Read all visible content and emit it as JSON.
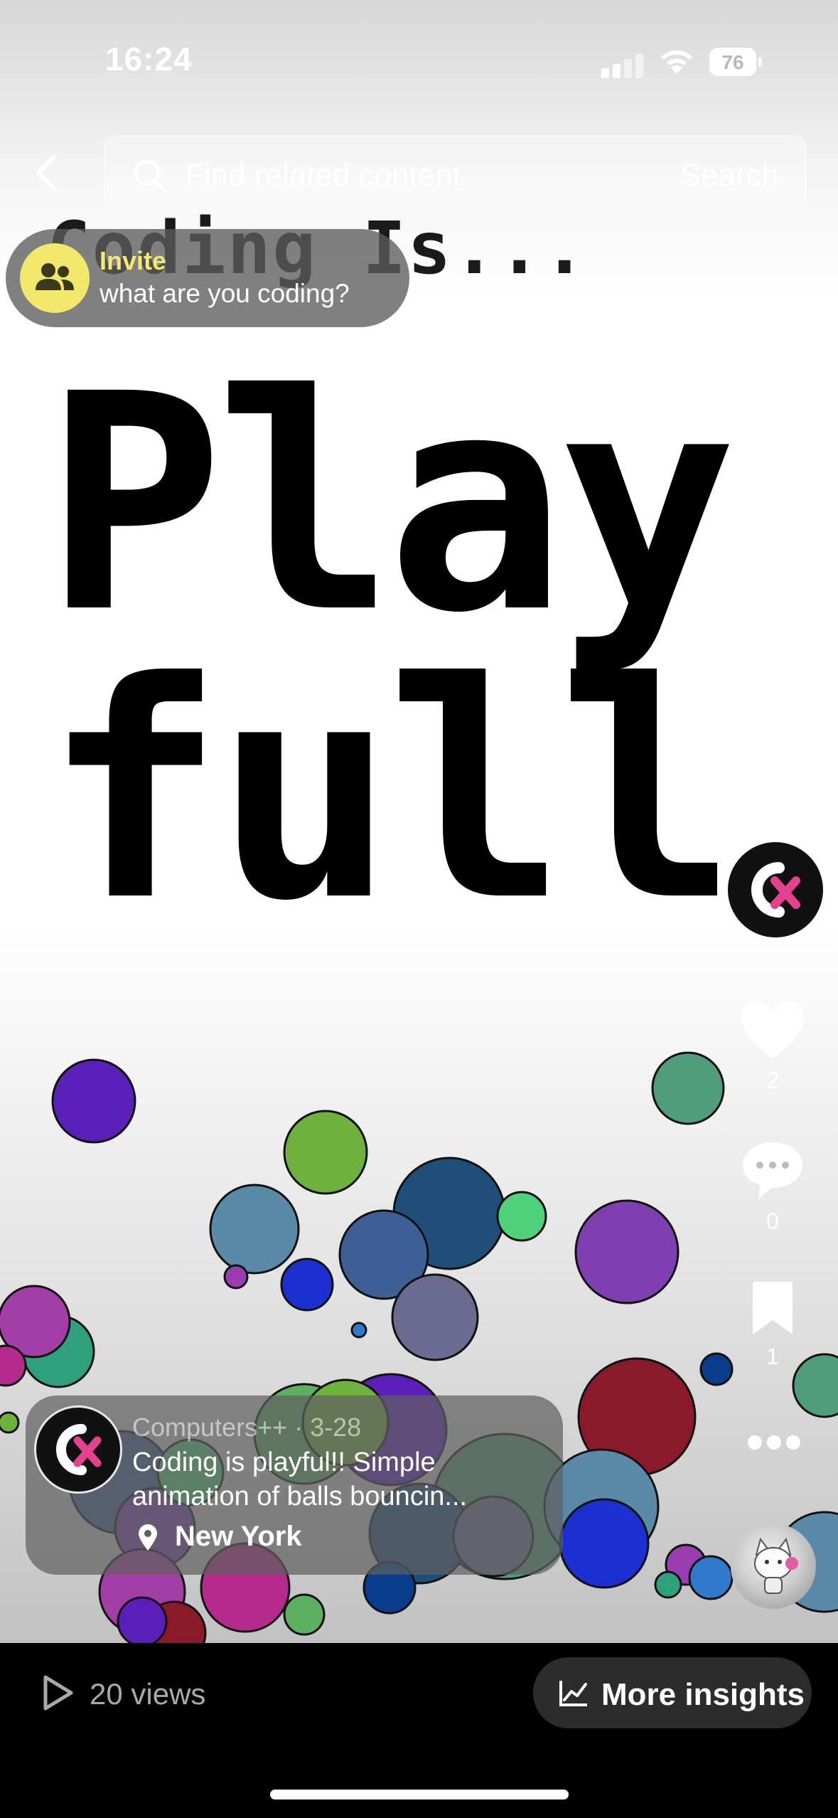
{
  "status_bar": {
    "time": "16:24",
    "battery": "76"
  },
  "search": {
    "placeholder": "Find related content",
    "button": "Search"
  },
  "video": {
    "line_small": "Coding Is...",
    "line_big_1": "Play",
    "line_big_2": "full",
    "ball_colors": [
      "#5a1fb8",
      "#6fb13d",
      "#4f9d7a",
      "#5b8aa8",
      "#1f4e7a",
      "#3d5f95",
      "#7f3fb0",
      "#4fd27a",
      "#6b6b8f",
      "#1c2fd0",
      "#9a3db0",
      "#2f7acc",
      "#2ea07c",
      "#a33ea6",
      "#b52b8d",
      "#8a1a2a",
      "#0a3c8c",
      "#5cb060"
    ]
  },
  "invite": {
    "label": "Invite",
    "question": "what are you coding?"
  },
  "rail": {
    "likes": "2",
    "comments": "0",
    "saves": "1"
  },
  "post": {
    "author_date": "Computers++ · 3-28",
    "caption": "Coding is playful!! Simple animation of balls bouncin...",
    "location": "New York"
  },
  "bottom": {
    "views": "20 views",
    "insights": "More insights"
  },
  "colors": {
    "accent_yellow": "#f1e76a",
    "logo_pink": "#e6418f",
    "bar_black": "#000000"
  }
}
